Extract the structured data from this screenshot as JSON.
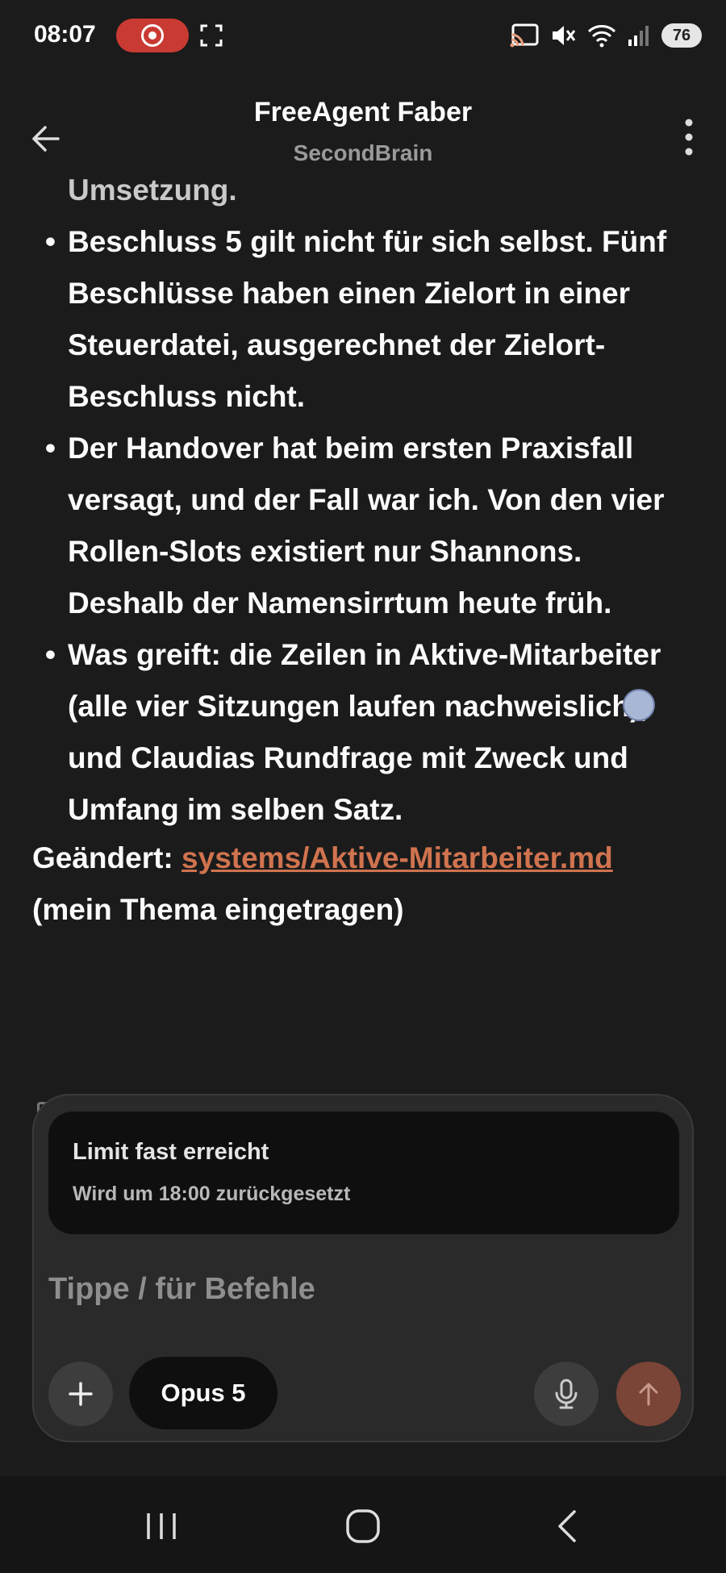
{
  "status_bar": {
    "time": "08:07",
    "battery": "76",
    "icons": [
      "screen-record-icon",
      "screenshot-frame-icon",
      "cast-icon",
      "mute-icon",
      "wifi-icon",
      "signal-icon",
      "battery-icon"
    ]
  },
  "header": {
    "title": "FreeAgent Faber",
    "subtitle": "SecondBrain"
  },
  "message": {
    "partial_line": "Umsetzung.",
    "bullets": [
      "Beschluss 5 gilt nicht für sich selbst. Fünf Beschlüsse haben einen Zielort in einer Steuerdatei, ausgerechnet der Zielort-Beschluss nicht.",
      "Der Handover hat beim ersten Praxisfall versagt, und der Fall war ich. Von den vier Rollen-Slots existiert nur Shannons. Deshalb der Namensirrtum heute früh.",
      "Was greift: die Zeilen in Aktive-Mitarbeiter (alle vier Sitzungen laufen nachweislich), und Claudias Rundfrage mit Zweck und Umfang im selben Satz."
    ],
    "changed_label": "Geändert:",
    "changed_link": "systems/Aktive-Mitarbeiter.md",
    "changed_note": "(mein Thema eingetragen)"
  },
  "composer": {
    "limit_title": "Limit fast erreicht",
    "limit_subtitle": "Wird um 18:00 zurückgesetzt",
    "placeholder": "Tippe / für Befehle",
    "model": "Opus 5"
  },
  "colors": {
    "background": "#1b1b1b",
    "link": "#d0734f",
    "send_button": "#7a4436",
    "record_pill": "#c93a32"
  }
}
